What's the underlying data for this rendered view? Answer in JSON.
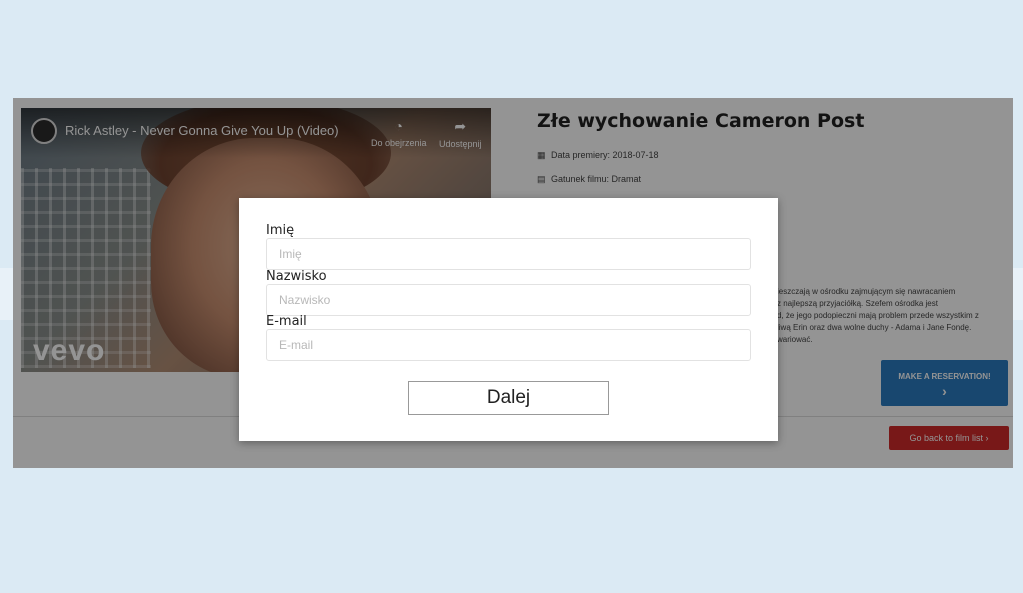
{
  "film": {
    "title": "Złe wychowanie Cameron Post",
    "premiere": "Data premiery: 2018-07-18",
    "genre": "Gatunek filmu: Dramat",
    "description_lines": [
      "ieszczają w ośrodku zajmującym się nawracaniem",
      "z najlepszą przyjaciółką. Szefem ośrodka jest",
      "d, że jego podopieczni mają problem przede wszystkim z",
      "liwą Erin oraz dwa wolne duchy - Adama i Jane Fondę.",
      "wariować."
    ],
    "reserve_label": "MAKE A RESERVATION!",
    "reserve_arrow": "›",
    "back_label": "Go back to film list  ›"
  },
  "video": {
    "title": "Rick Astley - Never Gonna Give You Up (Video)",
    "watch_later": "Do obejrzenia",
    "share": "Udostępnij",
    "brand": "vevo"
  },
  "modal": {
    "name_label": "Imię",
    "name_placeholder": "Imię",
    "surname_label": "Nazwisko",
    "surname_placeholder": "Nazwisko",
    "email_label": "E-mail",
    "email_placeholder": "E-mail",
    "next_label": "Dalej"
  },
  "colors": {
    "background": "#dbeaf4",
    "reserve_button": "#2a7bbf",
    "back_button": "#cf2a2a",
    "overlay": "rgba(0,0,0,0.42)"
  },
  "icons": [
    "clock-icon",
    "share-icon",
    "calendar-icon",
    "film-icon"
  ]
}
